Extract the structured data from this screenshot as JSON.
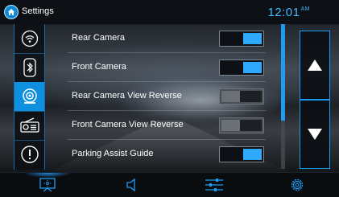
{
  "header": {
    "title": "Settings",
    "time": "12:01",
    "time_suffix": "AM",
    "home_icon": "home-icon"
  },
  "sidebar": {
    "items": [
      {
        "name": "wifi",
        "icon": "wifi-icon",
        "active": false
      },
      {
        "name": "bluetooth",
        "icon": "bluetooth-icon",
        "active": false
      },
      {
        "name": "camera",
        "icon": "camera-icon",
        "active": true
      },
      {
        "name": "radio",
        "icon": "radio-icon",
        "active": false
      },
      {
        "name": "alert",
        "icon": "alert-icon",
        "active": false
      }
    ]
  },
  "settings": {
    "rows": [
      {
        "label": "Rear Camera",
        "on": true
      },
      {
        "label": "Front Camera",
        "on": true
      },
      {
        "label": "Rear Camera View Reverse",
        "on": false
      },
      {
        "label": "Front Camera View Reverse",
        "on": false
      },
      {
        "label": "Parking Assist Guide",
        "on": true
      }
    ]
  },
  "scroll": {
    "position": "top"
  },
  "nav_buttons": {
    "up_icon": "up-arrow-icon",
    "down_icon": "down-arrow-icon"
  },
  "bottom_bar": {
    "items": [
      {
        "name": "display",
        "icon": "display-icon",
        "active": true
      },
      {
        "name": "volume",
        "icon": "volume-icon",
        "active": false
      },
      {
        "name": "equalizer",
        "icon": "equalizer-icon",
        "active": false
      },
      {
        "name": "settings",
        "icon": "gear-icon",
        "active": false
      }
    ]
  },
  "colors": {
    "accent": "#1f9bf2",
    "clock": "#45b8ff",
    "toggle_off": "#4a4f55"
  }
}
